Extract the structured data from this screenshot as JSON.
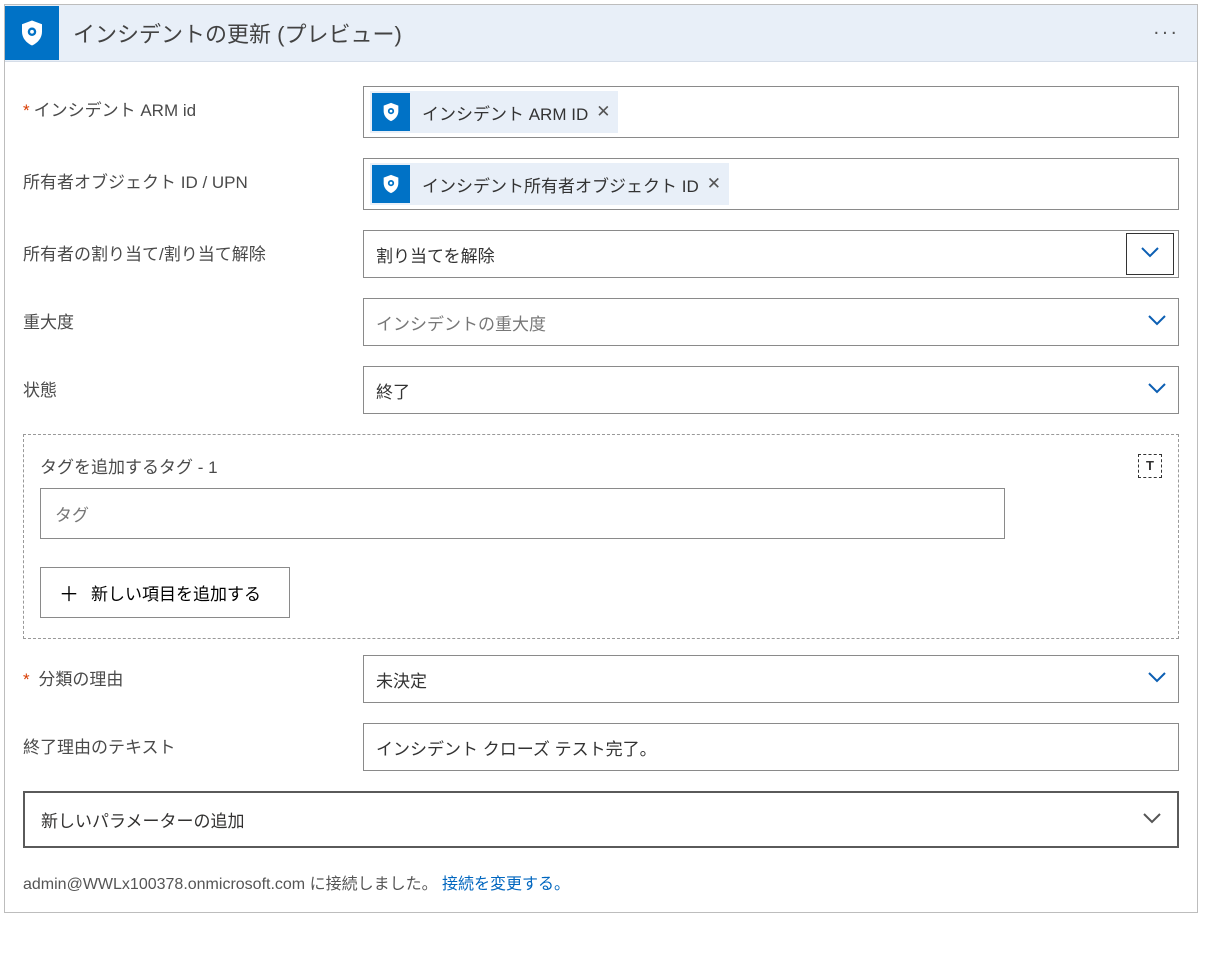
{
  "header": {
    "title": "インシデントの更新 (プレビュー)"
  },
  "fields": {
    "arm": {
      "label": "インシデント ARM id",
      "token": "インシデント ARM ID"
    },
    "owner": {
      "label": "所有者オブジェクト ID / UPN",
      "token": "インシデント所有者オブジェクト ID"
    },
    "assign": {
      "label": "所有者の割り当て/割り当て解除",
      "value": "割り当てを解除"
    },
    "severity": {
      "label": "重大度",
      "value": "インシデントの重大度"
    },
    "status": {
      "label": "状態",
      "value": "終了"
    },
    "classification": {
      "label": "分類の理由",
      "value": "未決定"
    },
    "closeReason": {
      "label": "終了理由のテキスト",
      "value": "インシデント クローズ テスト完了。"
    }
  },
  "tags": {
    "label": "タグを追加するタグ - 1",
    "placeholder": "タグ",
    "addButton": "新しい項目を追加する"
  },
  "newParam": {
    "label": "新しいパラメーターの追加"
  },
  "footer": {
    "text": "admin@WWLx100378.onmicrosoft.com に接続しました。 ",
    "link": "接続を変更する。"
  }
}
